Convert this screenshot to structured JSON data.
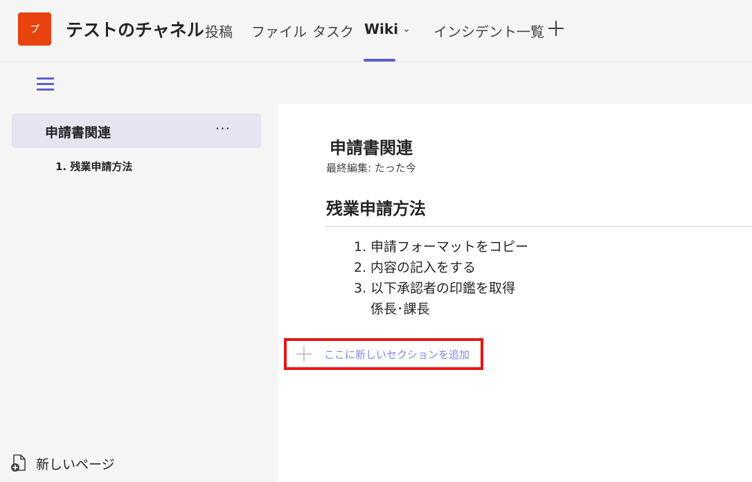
{
  "header": {
    "team_initial": "プ",
    "channel_title": "テストのチャネル",
    "tabs": [
      {
        "label": "投稿"
      },
      {
        "label": "ファイル"
      },
      {
        "label": "タスク"
      },
      {
        "label": "Wiki"
      },
      {
        "label": "インシデント一覧"
      }
    ],
    "active_tab": "Wiki"
  },
  "sidebar": {
    "selected_item": "申請書関連",
    "more_label": "···",
    "sub_items": [
      {
        "label": "1. 残業申請方法"
      }
    ],
    "new_page_label": "新しいページ"
  },
  "content": {
    "page_title": "申請書関連",
    "last_edited": "最終編集: たった今",
    "section_title": "残業申請方法",
    "list": [
      {
        "num": "1.",
        "text": "申請フォーマットをコピー"
      },
      {
        "num": "2.",
        "text": "内容の記入をする"
      },
      {
        "num": "3.",
        "text": "以下承認者の印鑑を取得"
      }
    ],
    "list_continuation": "係長･課長",
    "add_section_label": "ここに新しいセクションを追加"
  },
  "colors": {
    "accent": "#5b5fc7",
    "team_avatar": "#e8430e",
    "highlight_box": "#e81414",
    "add_section_text": "#7f85f5"
  }
}
